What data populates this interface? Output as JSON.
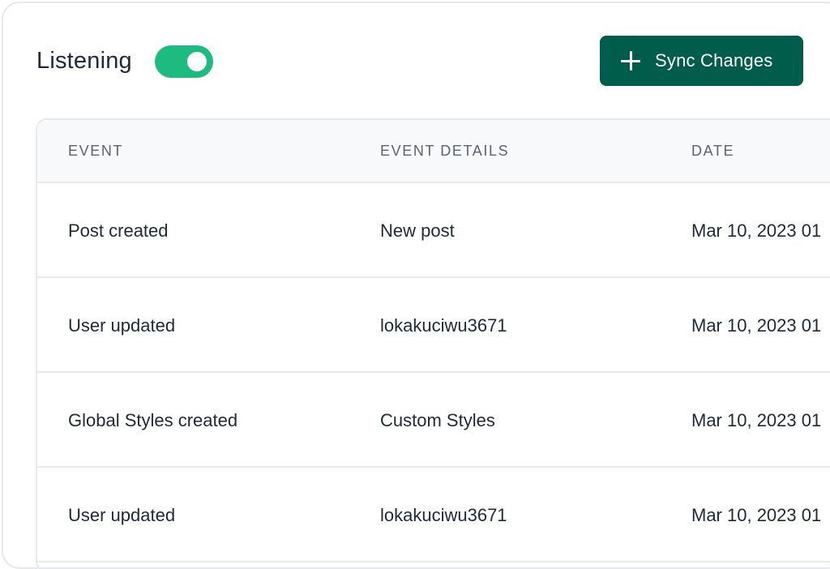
{
  "header": {
    "listening_label": "Listening",
    "listening_enabled": true,
    "sync_button_label": "Sync Changes",
    "sync_button_icon": "plus-icon"
  },
  "colors": {
    "toggle_on": "#1dbb7f",
    "button_bg": "#005c4b",
    "header_row_bg": "#f8f9fb",
    "text_primary": "#1f2937",
    "text_muted": "#5b6270"
  },
  "table": {
    "columns": [
      "EVENT",
      "EVENT DETAILS",
      "DATE"
    ],
    "rows": [
      {
        "event": "Post created",
        "details": "New post",
        "date": "Mar 10, 2023 01"
      },
      {
        "event": "User updated",
        "details": "lokakuciwu3671",
        "date": "Mar 10, 2023 01"
      },
      {
        "event": "Global Styles created",
        "details": "Custom Styles",
        "date": "Mar 10, 2023 01"
      },
      {
        "event": "User updated",
        "details": "lokakuciwu3671",
        "date": "Mar 10, 2023 01"
      }
    ]
  }
}
